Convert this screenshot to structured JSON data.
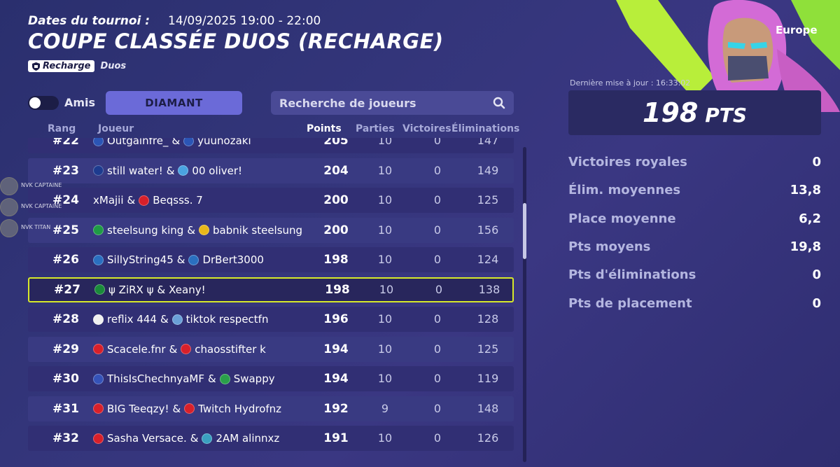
{
  "header": {
    "date_label": "Dates du tournoi :",
    "date_value": "14/09/2025 19:00 - 22:00",
    "title": "COUPE CLASSÉE DUOS (RECHARGE)",
    "mode_tag": "Recharge",
    "mode_sub": "Duos"
  },
  "filters": {
    "amis_label": "Amis",
    "division": "DIAMANT",
    "search_placeholder": "Recherche de joueurs"
  },
  "columns": {
    "rang": "Rang",
    "joueur": "Joueur",
    "points": "Points",
    "parties": "Parties",
    "victoires": "Victoires",
    "eliminations": "Éliminations"
  },
  "rows": [
    {
      "rank": "#22",
      "p1": "Outgainfre_",
      "p2": "yuunozaki",
      "f1": "#2b55b5",
      "f2": "#2b55b5",
      "pts": "205",
      "parties": "10",
      "vic": "0",
      "elim": "147",
      "partial": true
    },
    {
      "rank": "#23",
      "p1": "still water!",
      "p2": "00 oliver!",
      "f1": "#1d3b8f",
      "f2": "#4aa3e0",
      "pts": "204",
      "parties": "10",
      "vic": "0",
      "elim": "149"
    },
    {
      "rank": "#24",
      "p1": "xMajii",
      "p2": "Beqsss. 7",
      "f1": "",
      "f2": "#d8202a",
      "pts": "200",
      "parties": "10",
      "vic": "0",
      "elim": "125"
    },
    {
      "rank": "#25",
      "p1": "steelsung king",
      "p2": "babnik steelsung",
      "f1": "#1f9b45",
      "f2": "#e8b81a",
      "pts": "200",
      "parties": "10",
      "vic": "0",
      "elim": "156"
    },
    {
      "rank": "#26",
      "p1": "SillyString45",
      "p2": "DrBert3000",
      "f1": "#2a6fc0",
      "f2": "#2a6fc0",
      "pts": "198",
      "parties": "10",
      "vic": "0",
      "elim": "124"
    },
    {
      "rank": "#27",
      "p1": "ψ ZiRX ψ",
      "p2": "Xeany!",
      "f1": "#1a8a3a",
      "f2": "",
      "pts": "198",
      "parties": "10",
      "vic": "0",
      "elim": "138",
      "highlight": true
    },
    {
      "rank": "#28",
      "p1": "reflix 444",
      "p2": "tiktok respectfn",
      "f1": "#f0f0f0",
      "f2": "#6aa0d8",
      "pts": "196",
      "parties": "10",
      "vic": "0",
      "elim": "128"
    },
    {
      "rank": "#29",
      "p1": "Scacele.fnr",
      "p2": "chaosstifter k",
      "f1": "#d8202a",
      "f2": "#d8202a",
      "pts": "194",
      "parties": "10",
      "vic": "0",
      "elim": "125"
    },
    {
      "rank": "#30",
      "p1": "ThisIsChechnyaMF",
      "p2": "Swappy",
      "f1": "#3553b8",
      "f2": "#2aa04a",
      "pts": "194",
      "parties": "10",
      "vic": "0",
      "elim": "119"
    },
    {
      "rank": "#31",
      "p1": "BIG Teeqzy!",
      "p2": "Twitch Hydrofnz",
      "f1": "#d8202a",
      "f2": "#d8202a",
      "pts": "192",
      "parties": "9",
      "vic": "0",
      "elim": "148"
    },
    {
      "rank": "#32",
      "p1": "Sasha Versace.",
      "p2": "2AM alinnxz",
      "f1": "#d8202a",
      "f2": "#3aa0c0",
      "pts": "191",
      "parties": "10",
      "vic": "0",
      "elim": "126"
    }
  ],
  "sidebar_friends": [
    {
      "label": "NVK CAPTAINE"
    },
    {
      "label": "NVK CAPTAINE"
    },
    {
      "label": "NVK TITAN"
    }
  ],
  "right_panel": {
    "region": "Europe",
    "last_update": "Dernière mise à jour : 16:33:02",
    "total_points": "198",
    "points_unit": "PTS",
    "stats": [
      {
        "label": "Victoires royales",
        "value": "0"
      },
      {
        "label": "Élim. moyennes",
        "value": "13,8"
      },
      {
        "label": "Place moyenne",
        "value": "6,2"
      },
      {
        "label": "Pts moyens",
        "value": "19,8"
      },
      {
        "label": "Pts d'éliminations",
        "value": "0"
      },
      {
        "label": "Pts de placement",
        "value": "0"
      }
    ]
  },
  "colors": {
    "highlight_border": "#d7e92a",
    "division_button": "#6b6ad8",
    "region_accent": "#7ddc2a"
  }
}
